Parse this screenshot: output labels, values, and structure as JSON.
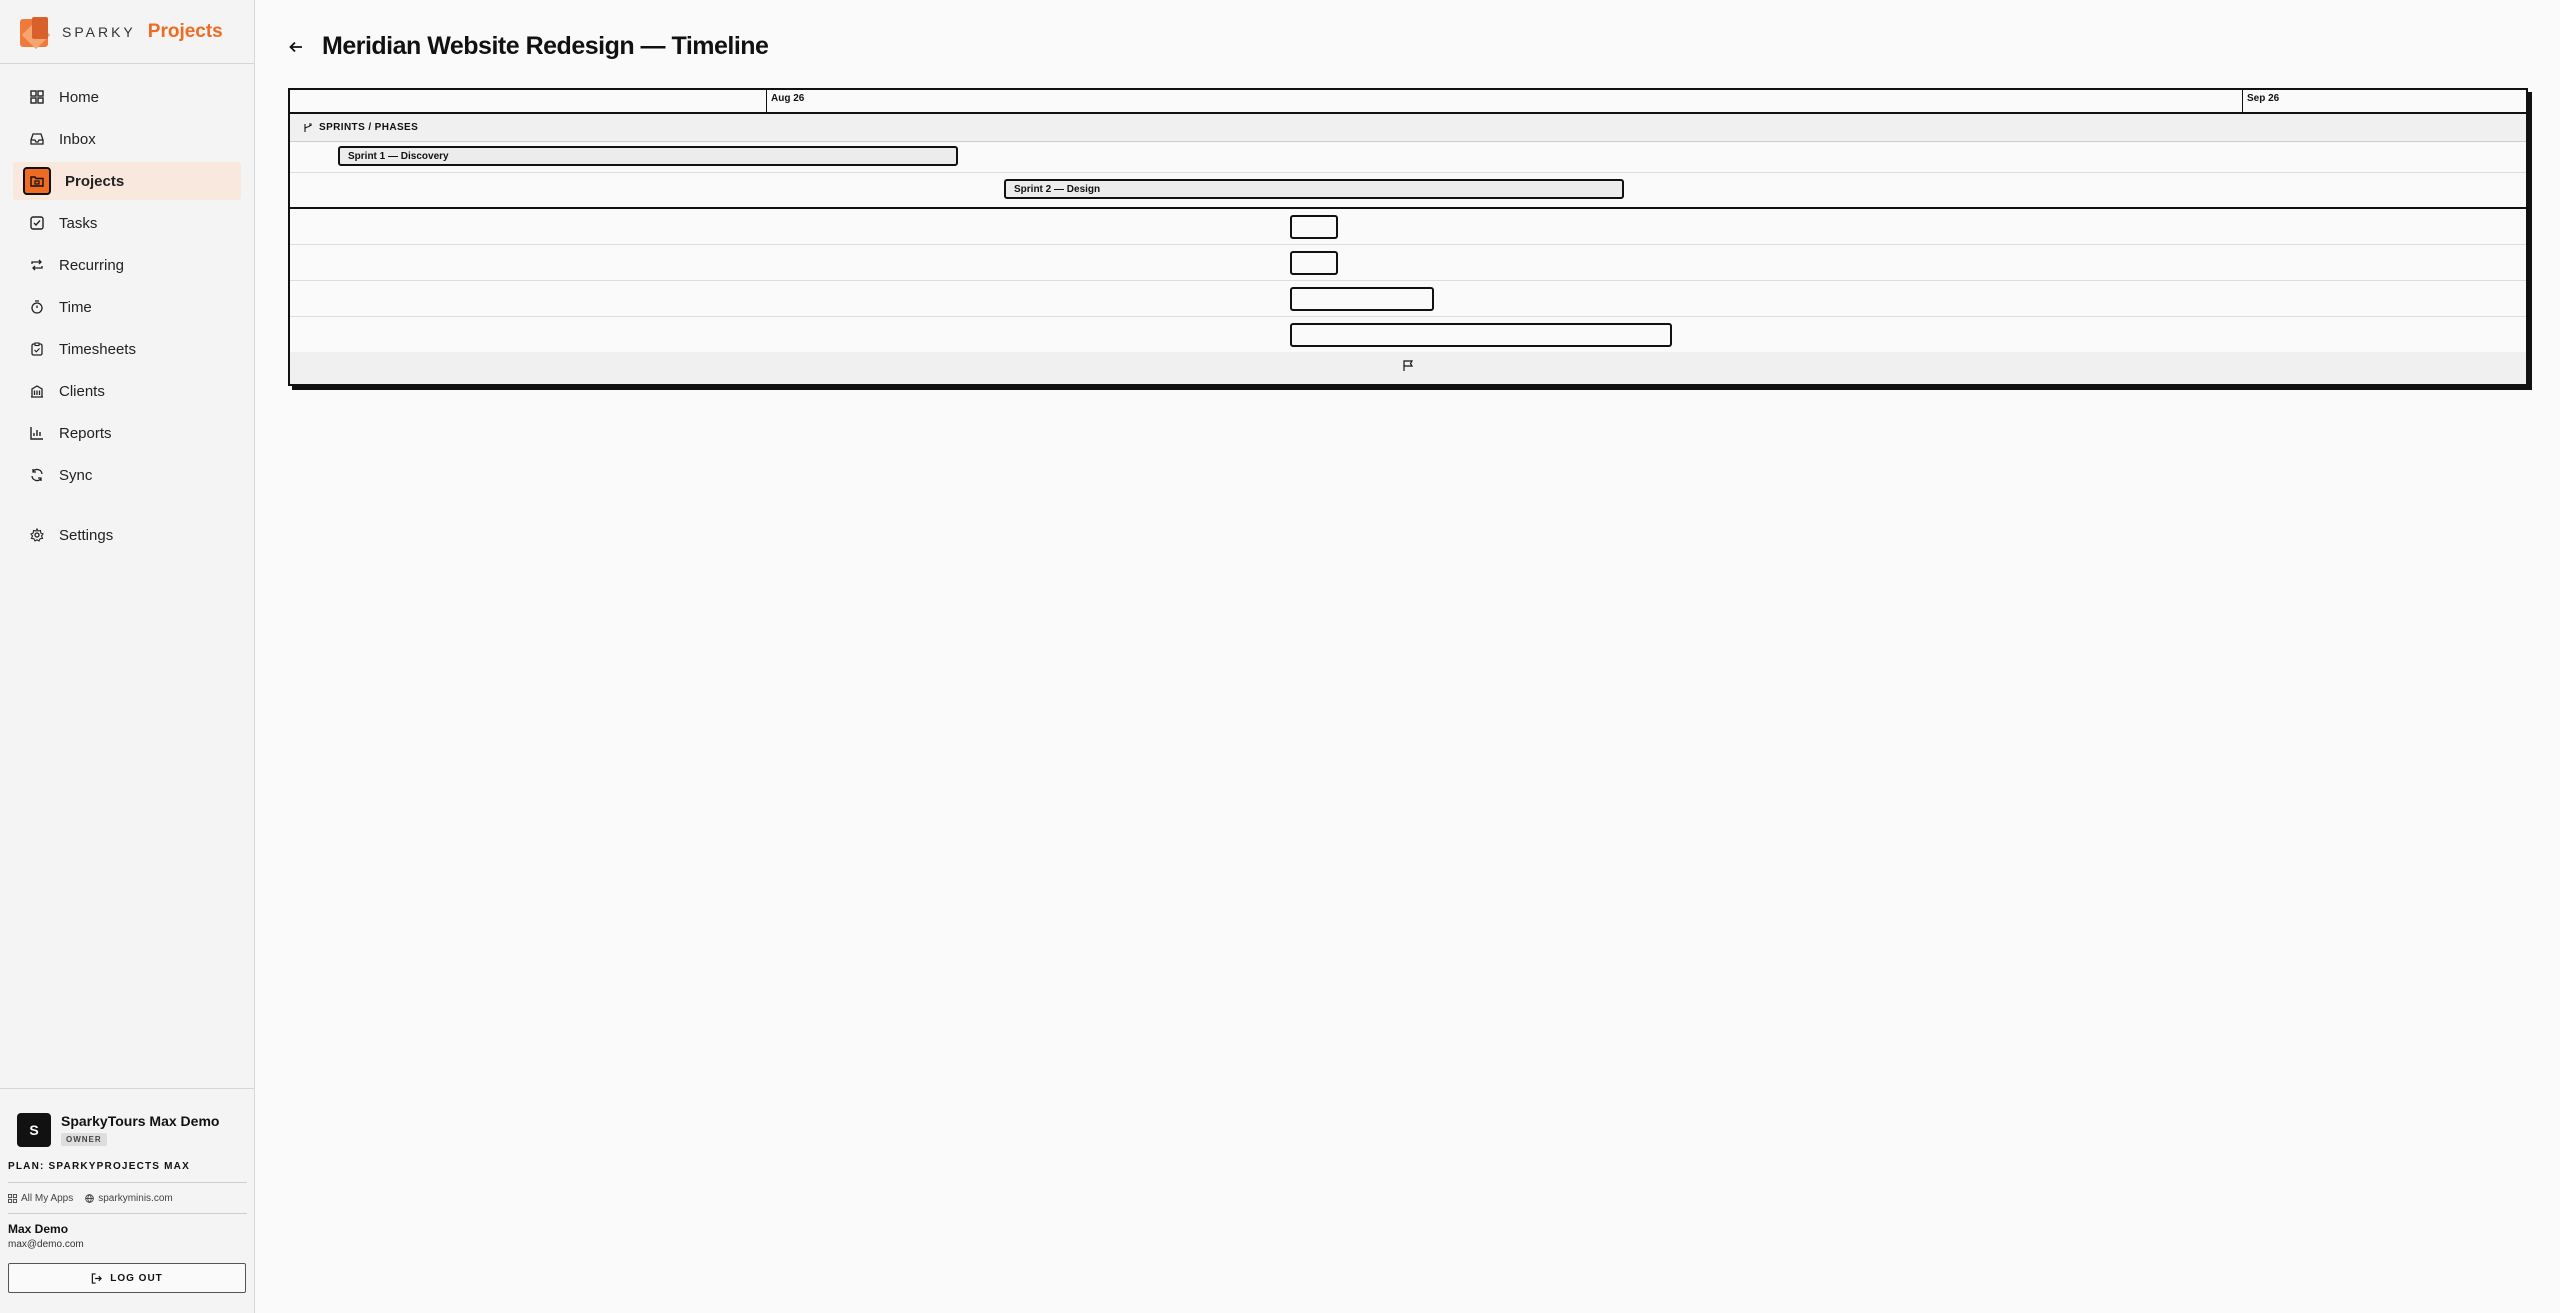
{
  "app": {
    "brand_prefix": "SPARKY",
    "brand_name": "Projects",
    "accent": "#ef6b23"
  },
  "sidebar": {
    "items": [
      {
        "label": "Home",
        "icon": "grid-icon"
      },
      {
        "label": "Inbox",
        "icon": "inbox-icon"
      },
      {
        "label": "Projects",
        "icon": "folder-icon",
        "active": true
      },
      {
        "label": "Tasks",
        "icon": "checkbox-icon"
      },
      {
        "label": "Recurring",
        "icon": "repeat-icon"
      },
      {
        "label": "Time",
        "icon": "stopwatch-icon"
      },
      {
        "label": "Timesheets",
        "icon": "clipboard-icon"
      },
      {
        "label": "Clients",
        "icon": "building-icon"
      },
      {
        "label": "Reports",
        "icon": "bar-chart-icon"
      },
      {
        "label": "Sync",
        "icon": "refresh-icon"
      }
    ],
    "settings_label": "Settings"
  },
  "account": {
    "avatar_initial": "S",
    "org_name": "SparkyTours Max Demo",
    "role_badge": "OWNER",
    "plan": "PLAN: SPARKYPROJECTS MAX",
    "link_apps": "All My Apps",
    "link_site": "sparkyminis.com",
    "user_name": "Max Demo",
    "user_email": "max@demo.com",
    "logout_label": "LOG OUT"
  },
  "page": {
    "title": "Meridian Website Redesign — Timeline"
  },
  "timeline": {
    "ticks": [
      "Aug 26",
      "Sep 26"
    ],
    "group_label": "SPRINTS / PHASES",
    "sprints": [
      "Sprint 1 — Discovery",
      "Sprint 2 — Design"
    ],
    "tasks": [
      "",
      "",
      "",
      ""
    ]
  }
}
